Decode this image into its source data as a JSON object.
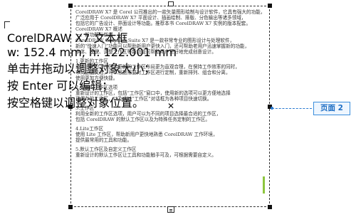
{
  "tooltip": {
    "lines": [
      "CorelDRAW X7 文本框",
      "w: 152.4 mm, h: 122.001 mm",
      "单击并拖动以调整对象大小；",
      "按 Enter 可以编辑；",
      "按空格键以调整对象位置。"
    ]
  },
  "text_frame": {
    "paragraphs": [
      "CorelDRAW X7 是 Corel 公司推出的一款矢量图形绘制与设计软件，它具有强大的功能，",
      "广泛应用于 CorelDRAW X7 平面设计、插画绘制、排版、分色输出等诸多领域，",
      "包括它的广告设计、界面设计等功能。推荐本书 CorelDRAW X7 实例的版本配套。",
      "CorelDRAW X7 概述",
      "一、新功能与新增",
      "CorelDRAW Graphics Suite X7 是一款非常专业的图形设计与处理软件，",
      "新的“快速入门”功能可以帮助新用户更快入门，还可帮助老用户迅速掌握新的功能，",
      "字体、模板、调整工作区等新功能可帮助用户更好地完成创意设计。",
      "",
      "1.更新的工作区",
      "重新设计的工作区，更新的工作区布局更为直观合理，在保持工作效率的同时，",
      "布局更加灵活，可以根据需要对工作区进行定制，重新排列、组合和分离，",
      "使用更加方便快捷。",
      "",
      "2.更新的工作区选项",
      "重新设计的工作区，包括“工作区”窗口中，使用新的选项可以更方便地选择",
      "已保存的工作区，以及通过“工作区”对话框为各种项目快速切换。",
      "",
      "3.工作区",
      "利用全新的工作区选项，用户可以为不同的项目选择最合适的工作区，",
      "包括 CorelDRAW 的默认工作区以及为特殊任务定制的工作区。",
      "",
      "4.Lite工作区",
      "使用 Lite 工作区，帮助新用户更快地熟悉 CorelDRAW 工作环境，",
      "提供最常用的工具和功能。",
      "",
      "5.默认工作区及自定义工作区",
      "重新设计的默认工作区让工具和功能触手可及，可根据需要自定义。"
    ]
  },
  "page_label": "页面 2",
  "colors": {
    "accent": "#2a7bd1",
    "label_fill": "#eef6ff",
    "text": "#333333",
    "green_marker": "#8dc63f"
  },
  "icons": {
    "cursor": "corner-cursor-icon",
    "center_marker": "x-center-icon",
    "bottom_handle": "text-flow-tab-icon"
  }
}
